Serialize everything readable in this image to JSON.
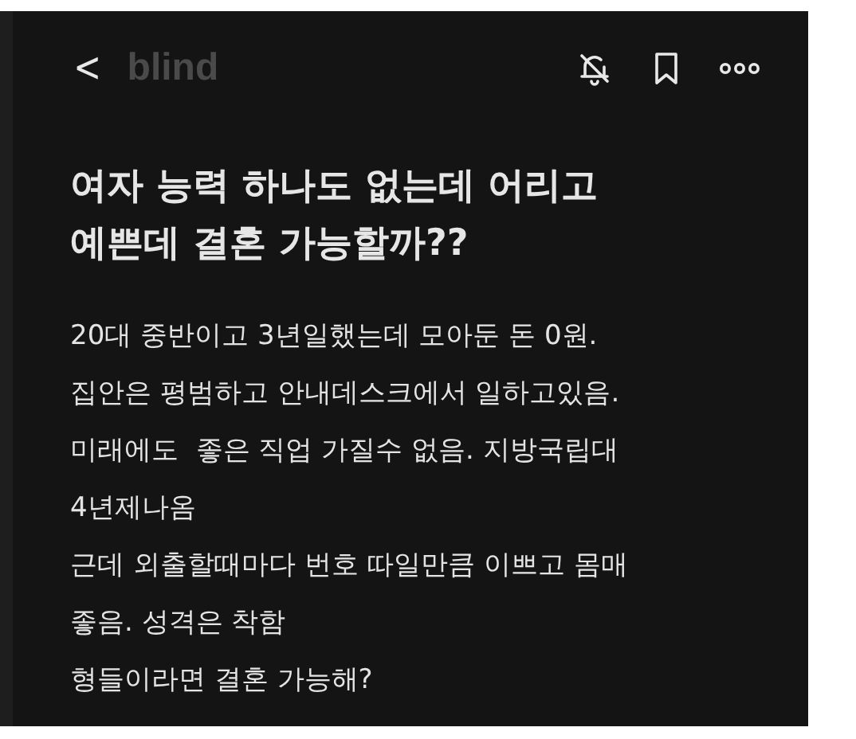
{
  "header": {
    "back": "<",
    "logo": "blind"
  },
  "post": {
    "title": "여자 능력 하나도 없는데 어리고 예쁜데 결혼 가능할까??",
    "body_lines": [
      "20대 중반이고 3년일했는데 모아둔 돈 0원.",
      "집안은 평범하고 안내데스크에서 일하고있음.",
      "미래에도  좋은 직업 가질수 없음. 지방국립대",
      "4년제나옴",
      "근데 외출할때마다 번호 따일만큼 이쁘고 몸매",
      "좋음. 성격은 착함",
      "형들이라면 결혼 가능해?"
    ]
  }
}
